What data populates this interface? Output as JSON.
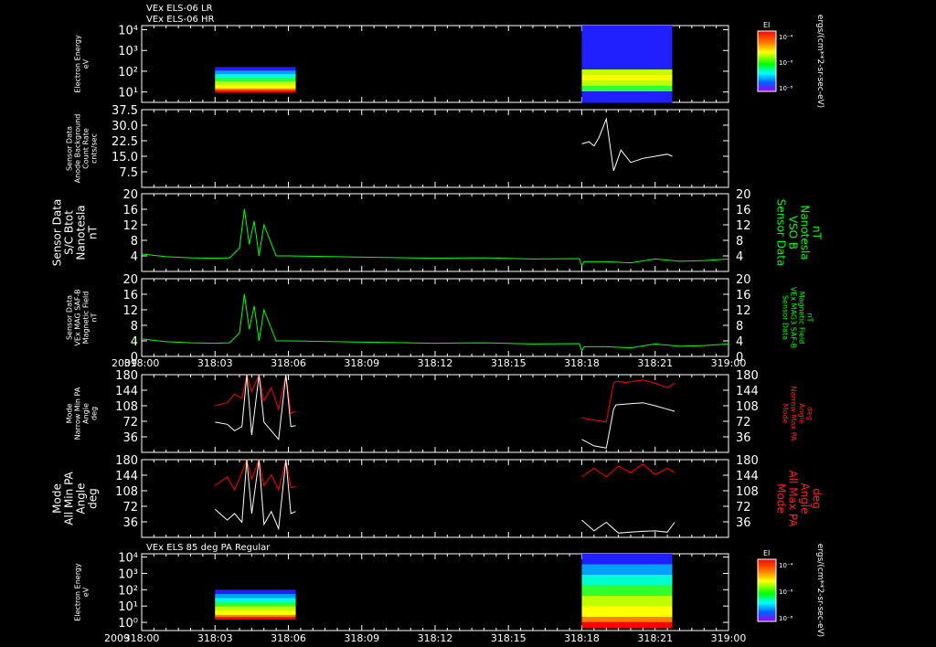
{
  "header": {
    "line1": "VEx ELS-06 LR",
    "line2": "VEx ELS-06 HR",
    "line3": "VEx ELS 85 deg PA Regular",
    "year": "2009"
  },
  "time_axis": {
    "ticks": [
      "318:00",
      "318:03",
      "318:06",
      "318:09",
      "318:12",
      "318:15",
      "318:18",
      "318:21",
      "319:00"
    ]
  },
  "colorbar": {
    "label": "EI",
    "ticks": [
      "10⁻⁴",
      "10⁻⁶",
      "10⁻⁸"
    ],
    "units": "ergs/(cm**2-sr-sec-eV)"
  },
  "chart_data": [
    {
      "type": "heatmap",
      "name": "els-lr-hr-spectrogram",
      "ylabel_lines": [
        "Electron Energy",
        "eV"
      ],
      "yticks": [
        "10⁴",
        "10³",
        "10²",
        "10¹"
      ],
      "ylim_log": [
        0.5,
        4.2
      ],
      "blocks": [
        {
          "t_start": 3.0,
          "t_end": 6.3,
          "e_low": 1.0,
          "e_high": 2.2
        },
        {
          "t_start": 18.0,
          "t_end": 21.7,
          "e_low": 0.5,
          "e_high": 4.2
        }
      ]
    },
    {
      "type": "line",
      "name": "sensor-data-anode-background",
      "ylabel_lines": [
        "Sensor Data",
        "Anode Background",
        "Count Rate",
        "cnts/sec"
      ],
      "yticks": [
        7.5,
        15.0,
        22.5,
        30.0,
        37.5
      ],
      "ylim": [
        0,
        37.5
      ],
      "series": [
        {
          "x": [
            18.0,
            18.3,
            18.5,
            18.7,
            19.0,
            19.3,
            19.6,
            20.0,
            20.5,
            21.0,
            21.5,
            21.7
          ],
          "y": [
            21,
            22,
            20,
            24,
            33,
            8,
            18,
            12,
            14,
            15,
            16,
            15
          ],
          "color": "#ffffff"
        }
      ]
    },
    {
      "type": "line",
      "name": "sc-btot",
      "ylabel_lines": [
        "Sensor Data",
        "S/C Btot",
        "Nanotesla",
        "nT"
      ],
      "right_label_lines": [
        "Sensor Data",
        "VSO B",
        "Nanotesla",
        "nT"
      ],
      "yticks": [
        4,
        8,
        12,
        16,
        20
      ],
      "ylim": [
        0,
        20
      ],
      "series": [
        {
          "x": [
            0,
            1,
            2,
            3,
            3.6,
            4.0,
            4.2,
            4.4,
            4.6,
            4.8,
            5.0,
            5.5,
            6,
            8,
            10,
            12,
            14,
            16,
            17.9,
            18.0,
            18.1,
            19,
            20,
            21,
            22,
            23,
            24
          ],
          "y": [
            4.5,
            3.8,
            3.5,
            3.4,
            3.5,
            6,
            16,
            7,
            13,
            4,
            12,
            4,
            4,
            3.8,
            3.6,
            3.4,
            3.5,
            3.2,
            3.3,
            1.5,
            2.5,
            2.5,
            2.2,
            3.2,
            2.6,
            2.8,
            3.2
          ],
          "color": "#00ff00"
        }
      ]
    },
    {
      "type": "line",
      "name": "vex-mag-saf-b",
      "ylabel_lines": [
        "Sensor Data",
        "VEx MAG SAF-B",
        "Magnetic Field",
        "nT"
      ],
      "right_label_lines": [
        "Sensor Data",
        "VEx MAG3 SAF-B",
        "Magnetic Field",
        "nT"
      ],
      "yticks": [
        0,
        4,
        8,
        12,
        16,
        20
      ],
      "ylim": [
        0,
        20
      ],
      "series": [
        {
          "x": [
            0,
            1,
            2,
            3,
            3.6,
            4.0,
            4.2,
            4.4,
            4.6,
            4.8,
            5.0,
            5.5,
            6,
            8,
            10,
            12,
            14,
            16,
            17.9,
            18.0,
            18.1,
            19,
            20,
            21,
            22,
            23,
            24
          ],
          "y": [
            4.5,
            3.8,
            3.5,
            3.4,
            3.5,
            6,
            16,
            7,
            13,
            4,
            12,
            4,
            4,
            3.8,
            3.6,
            3.4,
            3.5,
            3.2,
            3.3,
            1.5,
            2.5,
            2.5,
            2.2,
            3.2,
            2.6,
            2.8,
            3.2
          ],
          "color": "#00ff00"
        }
      ]
    },
    {
      "type": "line",
      "name": "narrow-pa",
      "ylabel_lines": [
        "Mode",
        "Narrow Min PA",
        "Angle",
        "deg"
      ],
      "right_label_lines": [
        "Mode",
        "Narrow Max PA",
        "Angle",
        "deg"
      ],
      "yticks": [
        36,
        72,
        108,
        144,
        180
      ],
      "ylim": [
        0,
        180
      ],
      "series": [
        {
          "x": [
            3.0,
            3.5,
            3.8,
            4.1,
            4.3,
            4.5,
            4.8,
            5.0,
            5.3,
            5.6,
            5.9,
            6.1,
            6.3
          ],
          "y": [
            108,
            115,
            135,
            125,
            180,
            140,
            180,
            120,
            150,
            100,
            180,
            90,
            95
          ],
          "color": "#ff0000"
        },
        {
          "x": [
            3.0,
            3.5,
            3.8,
            4.1,
            4.3,
            4.5,
            4.8,
            5.0,
            5.3,
            5.6,
            5.9,
            6.1,
            6.3
          ],
          "y": [
            70,
            65,
            50,
            60,
            180,
            40,
            180,
            70,
            50,
            30,
            180,
            60,
            62
          ],
          "color": "#ffffff"
        },
        {
          "x": [
            18.0,
            18.5,
            19.0,
            19.3,
            19.4,
            19.8,
            20.5,
            21.0,
            21.5,
            21.8
          ],
          "y": [
            80,
            75,
            70,
            160,
            165,
            162,
            168,
            160,
            150,
            160
          ],
          "color": "#ff0000"
        },
        {
          "x": [
            18.0,
            18.5,
            19.0,
            19.3,
            19.4,
            19.8,
            20.5,
            21.0,
            21.5,
            21.8
          ],
          "y": [
            30,
            15,
            10,
            100,
            110,
            112,
            115,
            108,
            100,
            95
          ],
          "color": "#ffffff"
        }
      ]
    },
    {
      "type": "line",
      "name": "all-pa",
      "ylabel_lines": [
        "Mode",
        "All Min PA",
        "Angle",
        "deg"
      ],
      "right_label_lines": [
        "Mode",
        "All Max PA",
        "Angle",
        "deg"
      ],
      "yticks": [
        36,
        72,
        108,
        144,
        180
      ],
      "ylim": [
        0,
        180
      ],
      "series": [
        {
          "x": [
            3.0,
            3.5,
            3.8,
            4.1,
            4.3,
            4.5,
            4.8,
            5.0,
            5.3,
            5.6,
            5.9,
            6.1,
            6.3
          ],
          "y": [
            120,
            140,
            110,
            150,
            180,
            135,
            180,
            120,
            145,
            110,
            180,
            115,
            118
          ],
          "color": "#ff0000"
        },
        {
          "x": [
            3.0,
            3.5,
            3.8,
            4.1,
            4.3,
            4.5,
            4.8,
            5.0,
            5.3,
            5.6,
            5.9,
            6.1,
            6.3
          ],
          "y": [
            65,
            40,
            55,
            35,
            180,
            55,
            180,
            30,
            60,
            20,
            180,
            55,
            60
          ],
          "color": "#ffffff"
        },
        {
          "x": [
            18.0,
            18.5,
            19.0,
            19.5,
            20.0,
            20.5,
            21.0,
            21.5,
            21.8
          ],
          "y": [
            140,
            160,
            140,
            165,
            150,
            170,
            145,
            160,
            150
          ],
          "color": "#ff0000"
        },
        {
          "x": [
            18.0,
            18.5,
            19.0,
            19.5,
            20.0,
            20.5,
            21.0,
            21.5,
            21.8
          ],
          "y": [
            40,
            15,
            35,
            10,
            12,
            14,
            15,
            12,
            35
          ],
          "color": "#ffffff"
        }
      ]
    },
    {
      "type": "heatmap",
      "name": "els-85deg-spectrogram",
      "ylabel_lines": [
        "Electron Energy",
        "eV"
      ],
      "yticks": [
        "10⁴",
        "10³",
        "10²",
        "10¹",
        "10⁰"
      ],
      "ylim_log": [
        -0.5,
        4.2
      ],
      "blocks": [
        {
          "t_start": 3.0,
          "t_end": 6.3,
          "e_low": 0.2,
          "e_high": 2.0
        },
        {
          "t_start": 18.0,
          "t_end": 21.7,
          "e_low": -0.3,
          "e_high": 4.2
        }
      ]
    }
  ]
}
